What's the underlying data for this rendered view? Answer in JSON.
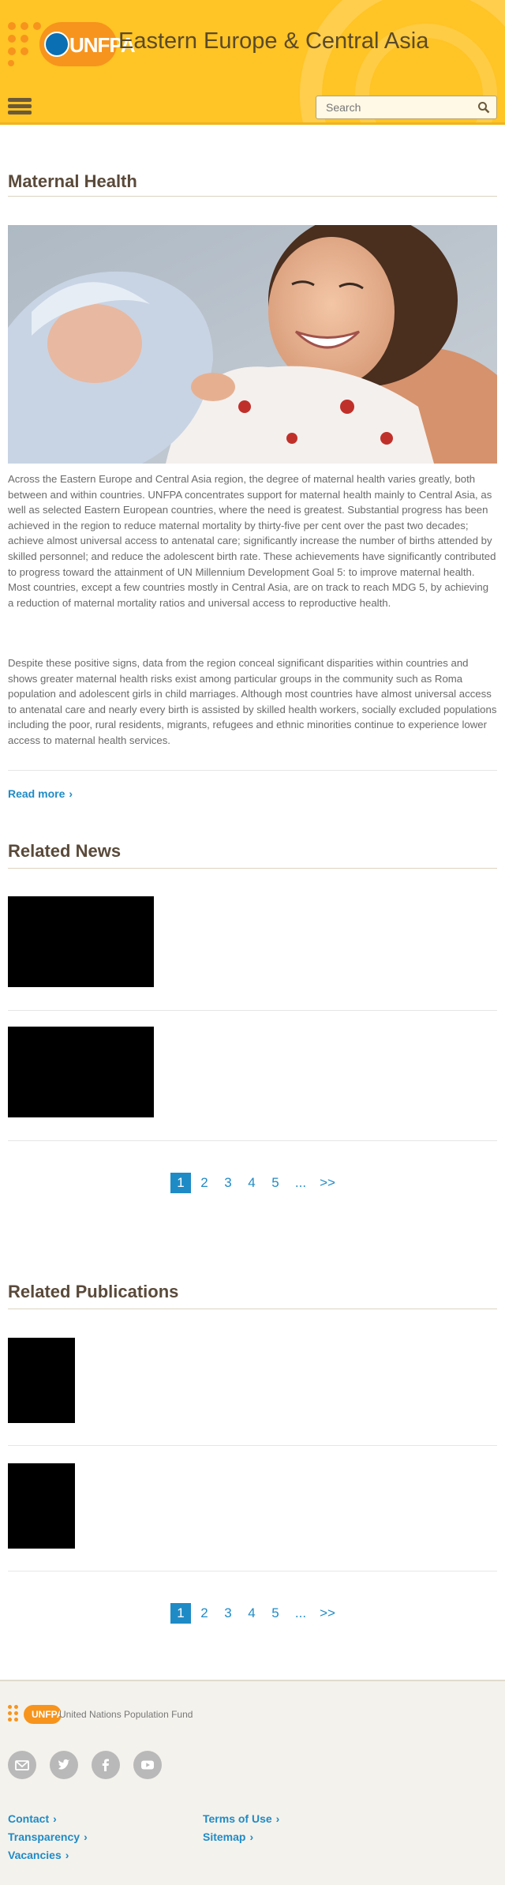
{
  "header": {
    "logo_text": "UNFPA",
    "site_title": "Eastern Europe & Central Asia",
    "search_placeholder": "Search",
    "brand_color": "#ffc425",
    "accent_color": "#f7941d"
  },
  "main": {
    "title": "Maternal Health",
    "paragraph_1": "Across the Eastern Europe and Central Asia region, the degree of maternal health varies greatly, both between and within countries. UNFPA concentrates support for maternal health mainly to Central Asia, as well as selected Eastern European countries, where the need is greatest. Substantial progress has been achieved in the region to reduce maternal mortality by thirty-five per cent over the past two decades; achieve almost universal access to antenatal care; significantly increase the number of births attended by skilled personnel; and reduce the adolescent birth rate. These achievements have significantly contributed to progress toward the attainment of UN Millennium Development Goal 5: to improve maternal health. Most countries, except a few countries mostly in Central Asia, are on track to reach MDG 5, by achieving a reduction of maternal mortality ratios and universal access to reproductive health.",
    "paragraph_2": "Despite these positive signs, data from the region conceal significant disparities within countries and shows greater maternal health risks exist among particular groups in the community such as Roma population and adolescent girls in child marriages. Although most countries have almost universal access to antenatal care and nearly every birth is assisted by skilled health workers, socially excluded populations including the poor, rural residents, migrants, refugees and ethnic minorities continue to experience lower access to maternal health services.",
    "read_more": "Read more"
  },
  "related_news": {
    "title": "Related News",
    "pager": [
      "1",
      "2",
      "3",
      "4",
      "5",
      "...",
      ">>"
    ],
    "active_page": "1"
  },
  "related_publications": {
    "title": "Related Publications",
    "pager": [
      "1",
      "2",
      "3",
      "4",
      "5",
      "...",
      ">>"
    ],
    "active_page": "1"
  },
  "footer": {
    "logo_text": "UNFPA",
    "org_name": "United Nations Population Fund",
    "social": [
      "email-icon",
      "twitter-icon",
      "facebook-icon",
      "youtube-icon"
    ],
    "links_left": [
      "Contact",
      "Transparency",
      "Vacancies"
    ],
    "links_right": [
      "Terms of Use",
      "Sitemap"
    ],
    "link_color": "#1f8bc6"
  }
}
